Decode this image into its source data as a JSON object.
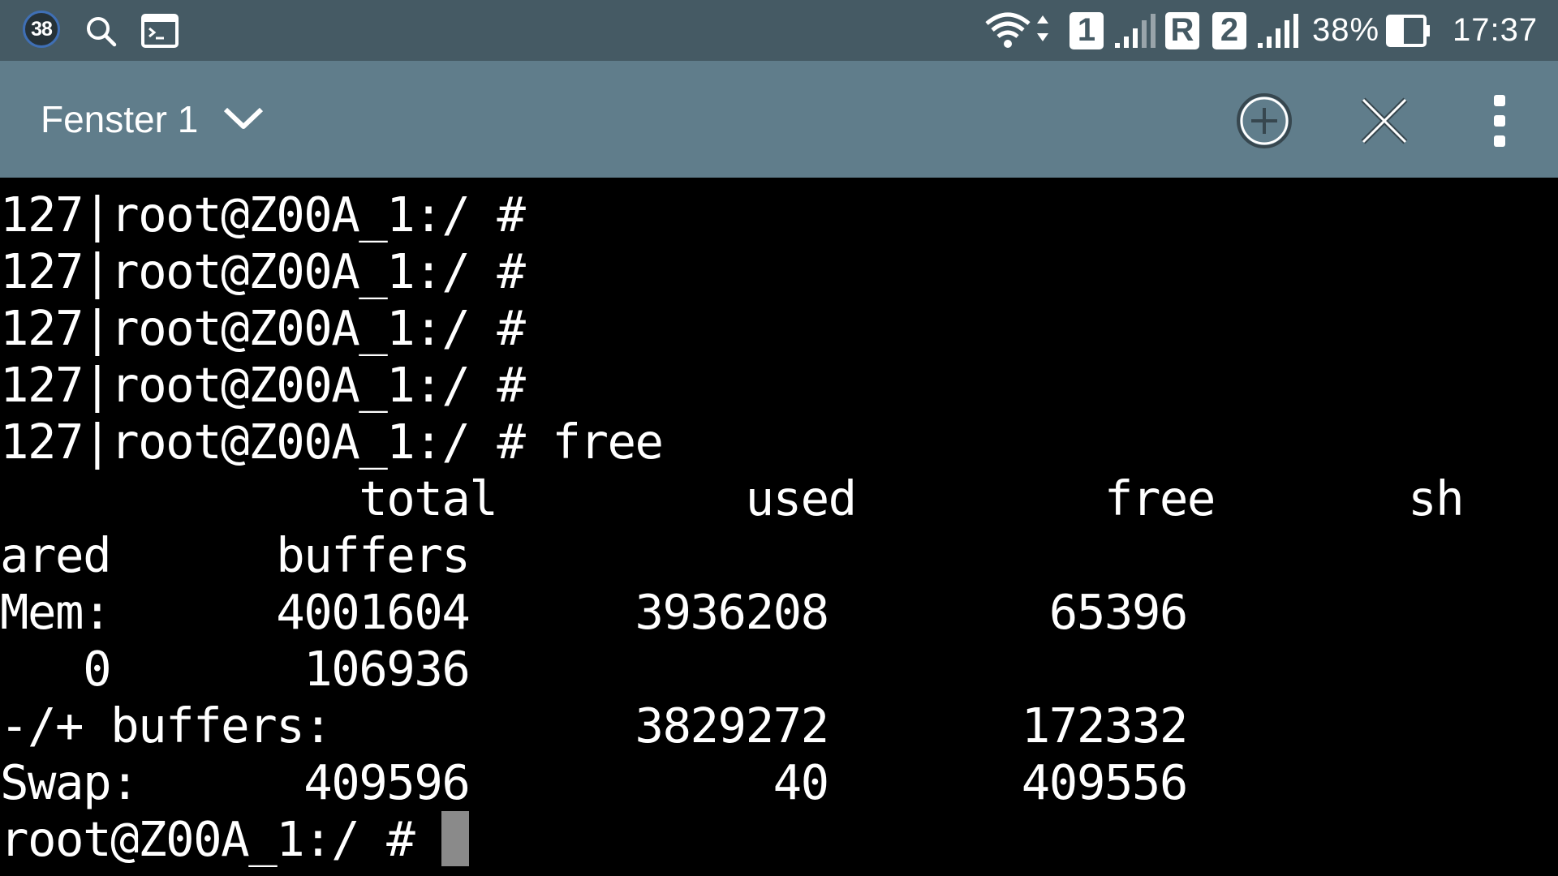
{
  "status_bar": {
    "notification_badge": "38",
    "sim1_label": "1",
    "roaming_label": "R",
    "sim2_label": "2",
    "battery": "38%",
    "clock": "17:37"
  },
  "toolbar": {
    "window_title": "Fenster 1"
  },
  "icons": {
    "status": [
      "search-icon",
      "terminal-icon",
      "wifi-icon",
      "signal-icon",
      "battery-icon"
    ],
    "toolbar": [
      "chevron-down-icon",
      "add-circle-icon",
      "close-icon",
      "more-vert-icon"
    ]
  },
  "colors": {
    "status_bar_bg": "#455a64",
    "toolbar_bg": "#607d8b",
    "terminal_bg": "#000000",
    "terminal_fg": "#ffffff",
    "cursor": "#8a8a8a"
  },
  "terminal": {
    "lines": [
      "127|root@Z00A_1:/ #",
      "127|root@Z00A_1:/ #",
      "127|root@Z00A_1:/ #",
      "127|root@Z00A_1:/ #",
      "127|root@Z00A_1:/ # free",
      "             total         used         free       sh",
      "ared      buffers",
      "Mem:      4001604      3936208        65396",
      "   0       106936",
      "-/+ buffers:           3829272       172332",
      "Swap:      409596           40       409556"
    ],
    "prompt": "root@Z00A_1:/ # "
  }
}
